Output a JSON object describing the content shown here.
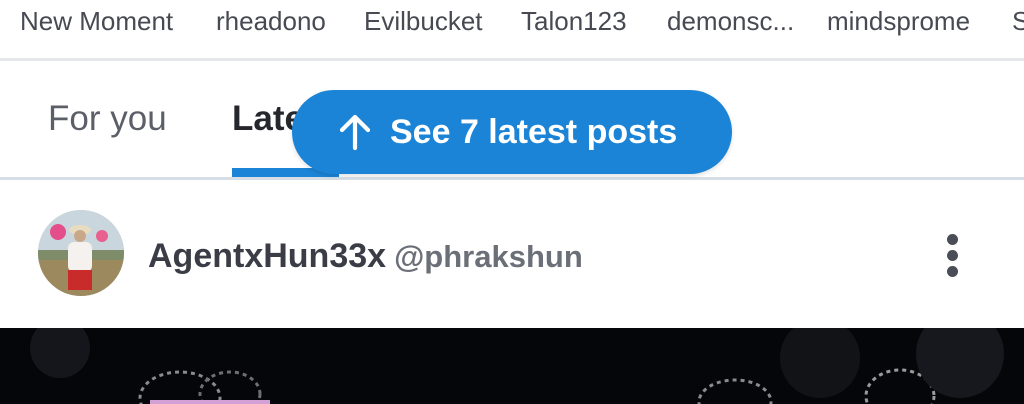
{
  "stories": [
    "New Moment",
    "rheadono",
    "Evilbucket",
    "Talon123",
    "demonsc...",
    "mindsprome",
    "S"
  ],
  "tabs": {
    "for_you": "For you",
    "latest": "Late"
  },
  "banner": {
    "label": "See 7 latest posts",
    "icon": "arrow-up-icon"
  },
  "post": {
    "display_name": "AgentxHun33x",
    "handle": "@phrakshun",
    "more_icon": "more-vertical-icon"
  },
  "colors": {
    "accent": "#1b84d6",
    "text": "#3a3d46",
    "muted": "#6b6f77",
    "media_bg": "#05060a"
  }
}
